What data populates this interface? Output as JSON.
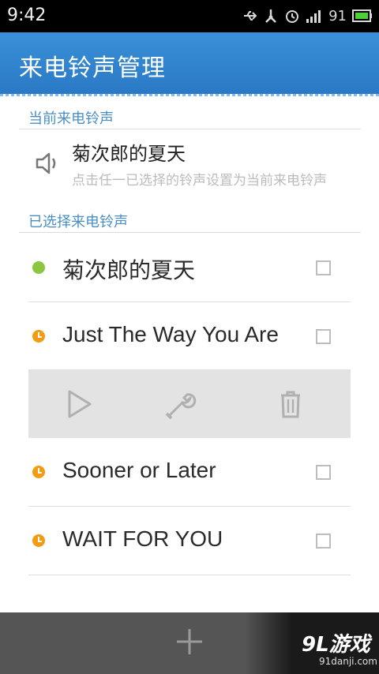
{
  "status_bar": {
    "time": "9:42",
    "battery_level": "91",
    "icons": [
      "usb-icon",
      "sync-icon",
      "alarm-icon",
      "signal-icon",
      "battery-icon"
    ]
  },
  "app_bar": {
    "title": "来电铃声管理"
  },
  "current_section": {
    "header": "当前来电铃声",
    "tone_name": "菊次郎的夏天",
    "hint": "点击任一已选择的铃声设置为当前来电铃声"
  },
  "selected_section": {
    "header": "已选择来电铃声",
    "tones": [
      {
        "name": "菊次郎的夏天",
        "status": "active",
        "checked": false
      },
      {
        "name": "Just The Way You Are",
        "status": "pending",
        "checked": false
      },
      {
        "name": "Sooner or Later",
        "status": "pending",
        "checked": false
      },
      {
        "name": "WAIT FOR YOU",
        "status": "pending",
        "checked": false
      }
    ]
  },
  "action_strip": {
    "actions": [
      "play-icon",
      "wrench-icon",
      "trash-icon"
    ]
  },
  "bottom_bar": {
    "add_icon": "plus-icon"
  },
  "watermark": {
    "brand": "9L游戏",
    "site": "91danji.com"
  },
  "colors": {
    "accent": "#2f84cf",
    "active_dot": "#8cc53e",
    "pending_dot": "#f39c12",
    "bottom_bar": "#555555"
  }
}
